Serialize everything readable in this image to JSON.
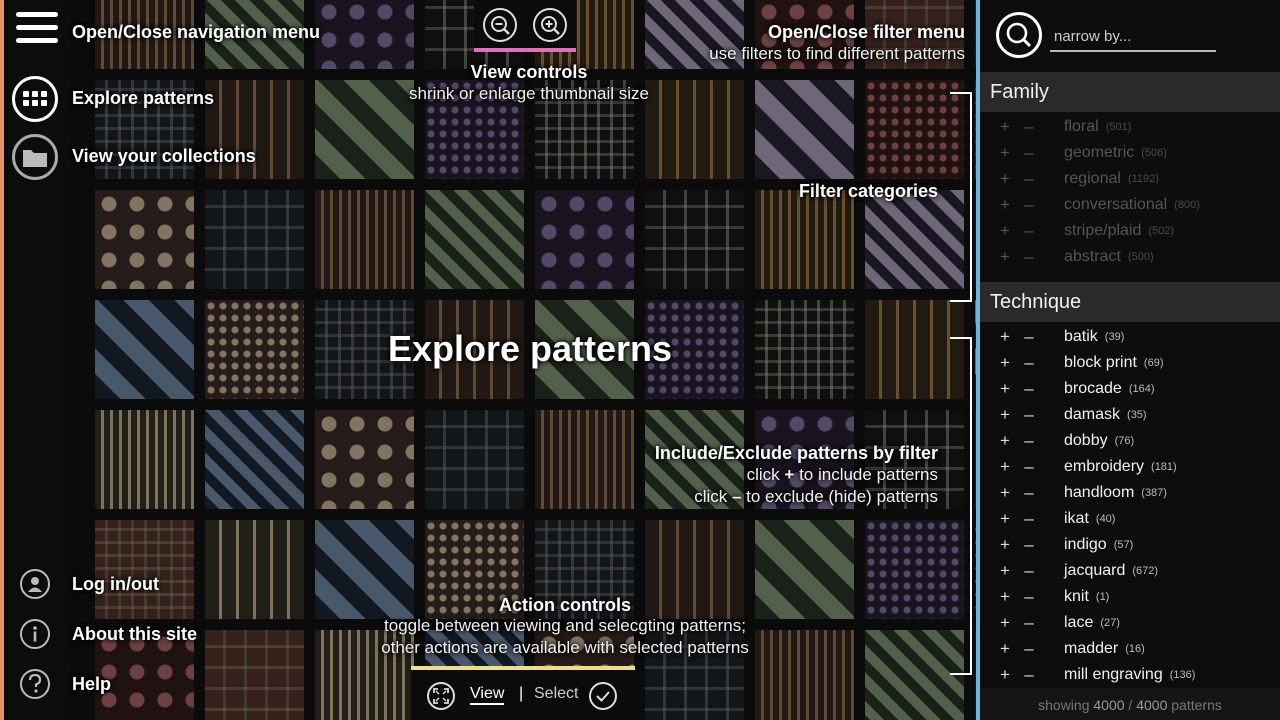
{
  "nav": {
    "menu_label": "Open/Close navigation menu",
    "explore_label": "Explore patterns",
    "collections_label": "View your collections",
    "login_label": "Log in/out",
    "about_label": "About this site",
    "help_label": "Help"
  },
  "view_controls": {
    "title": "View controls",
    "subtitle": "shrink or enlarge thumbnail size"
  },
  "filter_menu": {
    "title": "Open/Close filter menu",
    "subtitle": "use filters to find different patterns"
  },
  "center_title": "Explore patterns",
  "filter_categories_label": "Filter categories",
  "include_exclude": {
    "title": "Include/Exclude patterns by filter",
    "line1_a": "click ",
    "line1_symbol": "+",
    "line1_b": " to include patterns",
    "line2_a": "click ",
    "line2_symbol": "–",
    "line2_b": " to exclude (hide) patterns"
  },
  "action_controls": {
    "title": "Action controls",
    "line1": "toggle between viewing and selecgting patterns;",
    "line2": "other actions are available with selected patterns"
  },
  "action_bar": {
    "view_label": "View",
    "separator": "|",
    "select_label": "Select"
  },
  "search": {
    "placeholder": "narrow by..."
  },
  "family": {
    "heading": "Family",
    "items": [
      {
        "label": "floral",
        "count": "(501)"
      },
      {
        "label": "geometric",
        "count": "(506)"
      },
      {
        "label": "regional",
        "count": "(1192)"
      },
      {
        "label": "conversational",
        "count": "(800)"
      },
      {
        "label": "stripe/plaid",
        "count": "(502)"
      },
      {
        "label": "abstract",
        "count": "(500)"
      }
    ]
  },
  "technique": {
    "heading": "Technique",
    "items": [
      {
        "label": "batik",
        "count": "(39)"
      },
      {
        "label": "block print",
        "count": "(69)"
      },
      {
        "label": "brocade",
        "count": "(164)"
      },
      {
        "label": "damask",
        "count": "(35)"
      },
      {
        "label": "dobby",
        "count": "(76)"
      },
      {
        "label": "embroidery",
        "count": "(181)"
      },
      {
        "label": "handloom",
        "count": "(387)"
      },
      {
        "label": "ikat",
        "count": "(40)"
      },
      {
        "label": "indigo",
        "count": "(57)"
      },
      {
        "label": "jacquard",
        "count": "(672)"
      },
      {
        "label": "knit",
        "count": "(1)"
      },
      {
        "label": "lace",
        "count": "(27)"
      },
      {
        "label": "madder",
        "count": "(16)"
      },
      {
        "label": "mill engraving",
        "count": "(136)"
      }
    ]
  },
  "filter_symbols": {
    "plus": "+",
    "minus": "–"
  },
  "status": {
    "prefix": "showing ",
    "shown": "4000",
    "sep": " / ",
    "total": "4000",
    "suffix": " patterns"
  },
  "colors": {
    "nav_accent": "#e8915a",
    "zoom_accent": "#e36fb8",
    "action_accent": "#f0dd8a",
    "filter_accent": "#6cb4e6"
  }
}
